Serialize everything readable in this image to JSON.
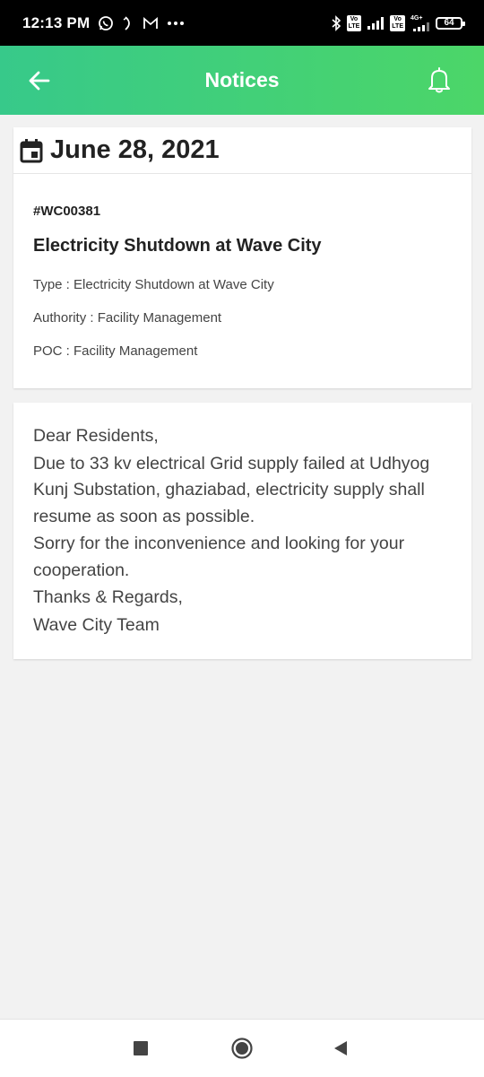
{
  "status_bar": {
    "time": "12:13 PM",
    "icons_left": [
      "whatsapp-icon",
      "moon-icon",
      "gmail-icon",
      "more-dots-icon"
    ],
    "volte_1": "Vo\nLTE",
    "volte_2": "Vo\nLTE",
    "network_label": "4G+",
    "battery": "64"
  },
  "app_bar": {
    "title": "Notices"
  },
  "notice": {
    "date": "June 28, 2021",
    "id": "#WC00381",
    "title": "Electricity Shutdown at Wave City",
    "type": "Type : Electricity Shutdown at Wave City",
    "authority": "Authority : Facility Management",
    "poc": "POC : Facility Management"
  },
  "message": {
    "greeting": "Dear Residents,",
    "paragraph_1": "Due to 33 kv electrical Grid supply failed at Udhyog Kunj Substation, ghaziabad, electricity supply shall resume as soon as possible.",
    "paragraph_2": "Sorry for the inconvenience and looking for your cooperation.",
    "closing": "Thanks & Regards,",
    "signature": "Wave City Team"
  },
  "colors": {
    "header_start": "#37c98a",
    "header_end": "#4cd668",
    "background": "#f2f2f2"
  }
}
